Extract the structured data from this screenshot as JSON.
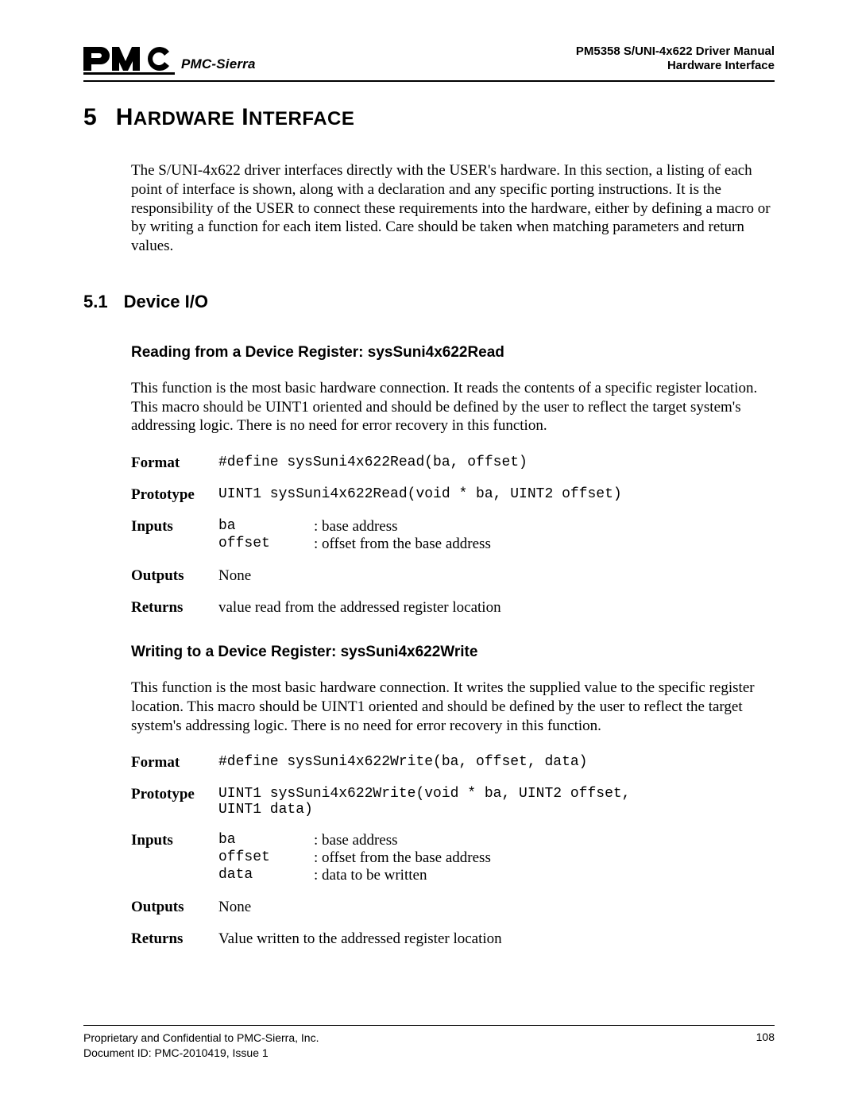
{
  "header": {
    "company": "PMC-Sierra",
    "doc_title": "PM5358 S/UNI-4x622 Driver Manual",
    "doc_section": "Hardware Interface"
  },
  "chapter": {
    "number": "5",
    "title_word1_first": "H",
    "title_word1_rest": "ARDWARE",
    "title_word2_first": "I",
    "title_word2_rest": "NTERFACE"
  },
  "intro": "The S/UNI-4x622 driver interfaces directly with the USER's hardware. In this section, a listing of each point of interface is shown, along with a declaration and any specific porting instructions. It is the responsibility of the USER to connect these requirements into the hardware, either by defining a macro or by writing a function for each item listed. Care should be taken when matching parameters and return values.",
  "section": {
    "number": "5.1",
    "title": "Device I/O"
  },
  "read": {
    "heading": "Reading from a Device Register: sysSuni4x622Read",
    "para": "This function is the most basic hardware connection. It reads the contents of a specific register location. This macro should be UINT1 oriented and should be defined by the user to reflect the target system's addressing logic. There is no need for error recovery in this function.",
    "format_label": "Format",
    "format_value": "#define sysSuni4x622Read(ba, offset)",
    "prototype_label": "Prototype",
    "prototype_value": "UINT1 sysSuni4x622Read(void * ba, UINT2 offset)",
    "inputs_label": "Inputs",
    "inputs": [
      {
        "name": "ba",
        "desc": ": base address"
      },
      {
        "name": "offset",
        "desc": ": offset from the base address"
      }
    ],
    "outputs_label": "Outputs",
    "outputs_value": "None",
    "returns_label": "Returns",
    "returns_value": "value read from the addressed register location"
  },
  "write": {
    "heading": "Writing to a Device Register: sysSuni4x622Write",
    "para": "This function is the most basic hardware connection. It writes the supplied value to the specific register location. This macro should be UINT1 oriented and should be defined by the user to reflect the target system's addressing logic. There is no need for error recovery in this function.",
    "format_label": "Format",
    "format_value": "#define sysSuni4x622Write(ba, offset, data)",
    "prototype_label": "Prototype",
    "prototype_value": "UINT1 sysSuni4x622Write(void * ba, UINT2 offset,\nUINT1 data)",
    "inputs_label": "Inputs",
    "inputs": [
      {
        "name": "ba",
        "desc": ": base address"
      },
      {
        "name": "offset",
        "desc": ": offset from the base address"
      },
      {
        "name": "data",
        "desc": ": data to be written"
      }
    ],
    "outputs_label": "Outputs",
    "outputs_value": "None",
    "returns_label": "Returns",
    "returns_value": "Value written to the addressed register location"
  },
  "footer": {
    "line1": "Proprietary and Confidential to PMC-Sierra, Inc.",
    "line2": "Document ID: PMC-2010419, Issue 1",
    "page": "108"
  }
}
